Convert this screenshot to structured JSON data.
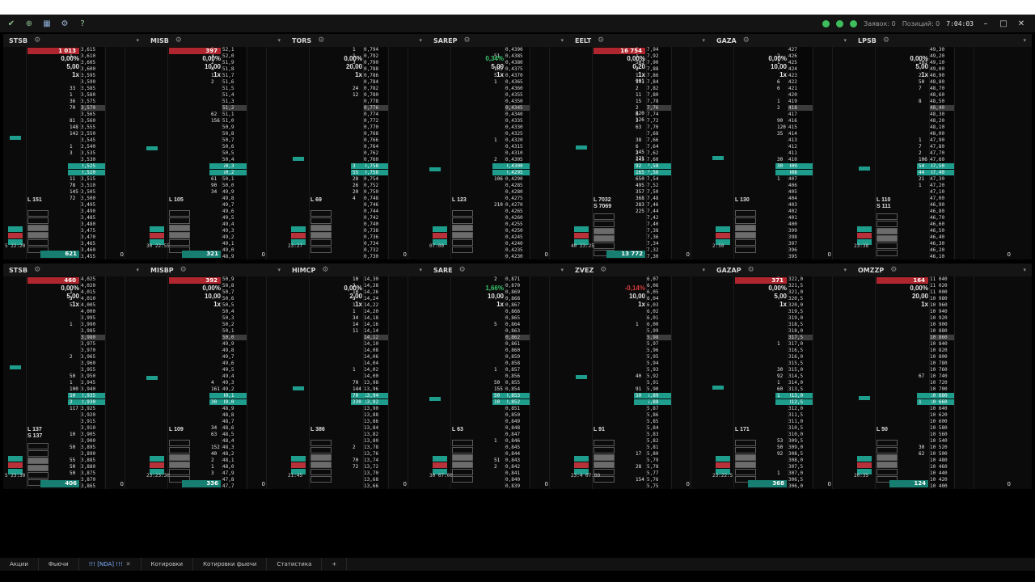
{
  "window": {
    "status_text_1": "Заявок: 0",
    "status_text_2": "Позиций: 0",
    "clock": "7:04:03"
  },
  "panels_top": [
    {
      "ticker": "STSB",
      "redbar": "1 013",
      "pct": "0,00%",
      "lot": "5,00",
      "mult": "1x",
      "ls": [
        "L 151"
      ],
      "bottom": "621",
      "time": "5 22:20",
      "prices": [
        "3,615",
        "3,610",
        "3,605",
        "3,600",
        "3,595",
        "3,590",
        "3,585",
        "3,580",
        "3,575",
        "3,570",
        "3,565",
        "3,560",
        "3,555",
        "3,550",
        "3,545",
        "3,540",
        "3,535",
        "3,530",
        "3,525",
        "3,520",
        "3,515",
        "3,510",
        "3,505",
        "3,500",
        "3,495",
        "3,490",
        "3,485",
        "3,480",
        "3,475",
        "3,470",
        "3,465",
        "3,460",
        "3,455"
      ],
      "vols": [
        "",
        "1",
        "",
        "",
        "",
        "",
        "33",
        "1",
        "36",
        "70",
        "",
        "81",
        "148",
        "142",
        "",
        "1",
        "3",
        "",
        "",
        "",
        "11",
        "78",
        "145",
        "72",
        "",
        "",
        "",
        "",
        "",
        "",
        "",
        "",
        ""
      ]
    },
    {
      "ticker": "MISB",
      "redbar": "397",
      "pct": "0,00%",
      "lot": "10,00",
      "mult": "1x",
      "ls": [
        "L 105"
      ],
      "bottom": "321",
      "time": "30 22:55",
      "prices": [
        "52,1",
        "52,0",
        "51,9",
        "51,8",
        "51,7",
        "51,6",
        "51,5",
        "51,4",
        "51,3",
        "51,2",
        "51,1",
        "51,0",
        "50,9",
        "50,8",
        "50,7",
        "50,6",
        "50,5",
        "50,4",
        "50,3",
        "50,2",
        "50,1",
        "50,0",
        "49,9",
        "49,8",
        "49,7",
        "49,6",
        "49,5",
        "49,4",
        "49,3",
        "49,2",
        "49,1",
        "49,0",
        "48,9"
      ],
      "vols": [
        "1",
        "3",
        "2",
        "4",
        "1",
        "2",
        "",
        "",
        "",
        "",
        "62",
        "156",
        "",
        "",
        "",
        "",
        "",
        "",
        "",
        "",
        "61",
        "90",
        "34",
        "",
        "",
        "",
        "",
        "",
        "",
        "",
        "",
        "",
        ""
      ]
    },
    {
      "ticker": "TORS",
      "redbar": "",
      "pct": "0,00%",
      "lot": "20,00",
      "mult": "1x",
      "ls": [
        "L 69"
      ],
      "bottom": "",
      "time": "23:27",
      "prices": [
        "0,794",
        "0,792",
        "0,790",
        "0,788",
        "0,786",
        "0,784",
        "0,782",
        "0,780",
        "0,778",
        "0,776",
        "0,774",
        "0,772",
        "0,770",
        "0,768",
        "0,766",
        "0,764",
        "0,762",
        "0,760",
        "0,758",
        "0,756",
        "0,754",
        "0,752",
        "0,750",
        "0,748",
        "0,746",
        "0,744",
        "0,742",
        "0,740",
        "0,738",
        "0,736",
        "0,734",
        "0,732",
        "0,730"
      ],
      "vols": [
        "1",
        "1",
        "3",
        "",
        "",
        "",
        "24",
        "12",
        "",
        "",
        "",
        "",
        "",
        "",
        "",
        "",
        "",
        "",
        "3",
        "55",
        "28",
        "26",
        "20",
        "4",
        "",
        "",
        "",
        "",
        "",
        "",
        "",
        "",
        ""
      ]
    },
    {
      "ticker": "SAREP",
      "redbar": "",
      "pct": "0,34%",
      "lot": "5,00",
      "mult": "1x",
      "ls": [
        "L 123"
      ],
      "bottom": "",
      "time": "07:00",
      "prices": [
        "0,4390",
        "0,4385",
        "0,4380",
        "0,4375",
        "0,4370",
        "0,4365",
        "0,4360",
        "0,4355",
        "0,4350",
        "0,4345",
        "0,4340",
        "0,4335",
        "0,4330",
        "0,4325",
        "0,4320",
        "0,4315",
        "0,4310",
        "0,4305",
        "0,4300",
        "0,4295",
        "0,4290",
        "0,4285",
        "0,4280",
        "0,4275",
        "0,4270",
        "0,4265",
        "0,4260",
        "0,4255",
        "0,4250",
        "0,4245",
        "0,4240",
        "0,4235",
        "0,4230"
      ],
      "vols": [
        "",
        "51",
        "",
        "105",
        "5",
        "1",
        "",
        "",
        "",
        "",
        "",
        "",
        "",
        "",
        "1",
        "",
        "",
        "2",
        "",
        "",
        "106",
        "",
        "",
        "",
        "210",
        "",
        "",
        "",
        "",
        "",
        "",
        "",
        ""
      ]
    },
    {
      "ticker": "EELT",
      "redbar": "16 754",
      "pct": "0,00%",
      "lot": "0,20",
      "mult": "1x",
      "ls": [
        "L 7032",
        "S 7069"
      ],
      "bottom": "13 772",
      "time": "40 23:25",
      "prices": [
        "7,94",
        "7,92",
        "7,90",
        "7,88",
        "7,86",
        "7,84",
        "7,82",
        "7,80",
        "7,78",
        "7,76",
        "7,74",
        "7,72",
        "7,70",
        "7,68",
        "7,66",
        "7,64",
        "7,62",
        "7,60",
        "7,58",
        "7,56",
        "7,54",
        "7,52",
        "7,50",
        "7,48",
        "7,46",
        "7,44",
        "7,42",
        "7,40",
        "7,38",
        "7,36",
        "7,34",
        "7,32",
        "7,30"
      ],
      "vols": [
        "2",
        "1",
        "503",
        "2",
        "1 001",
        "191",
        "2",
        "11",
        "15",
        "2 820",
        "6 126",
        "2",
        "63",
        "",
        "38",
        "6 145",
        "2 271",
        "145",
        "92",
        "165",
        "650",
        "495",
        "357",
        "368",
        "283",
        "225",
        "",
        "",
        "",
        "",
        "",
        "",
        ""
      ]
    },
    {
      "ticker": "GAZA",
      "redbar": "",
      "pct": "0,00%",
      "lot": "10,00",
      "mult": "1x",
      "ls": [
        "L 130"
      ],
      "bottom": "",
      "time": "2:50",
      "prices": [
        "427",
        "426",
        "425",
        "424",
        "423",
        "422",
        "421",
        "420",
        "419",
        "418",
        "417",
        "416",
        "415",
        "414",
        "413",
        "412",
        "411",
        "410",
        "409",
        "408",
        "407",
        "406",
        "405",
        "404",
        "403",
        "402",
        "401",
        "400",
        "399",
        "398",
        "397",
        "396",
        "395"
      ],
      "vols": [
        "",
        "2",
        "1",
        "",
        "",
        "6",
        "6",
        "",
        "1",
        "2",
        "",
        "90",
        "120",
        "35",
        "",
        "",
        "",
        "30",
        "30",
        "",
        "1",
        "",
        "",
        "",
        "",
        "",
        "",
        "",
        "",
        "",
        "",
        "",
        ""
      ]
    },
    {
      "ticker": "LPSB",
      "redbar": "",
      "pct": "0,00%",
      "lot": "5,00",
      "mult": "1x",
      "ls": [
        "L 110",
        "S 111"
      ],
      "bottom": "",
      "time": "23:38",
      "prices": [
        "49,30",
        "49,20",
        "49,10",
        "49,00",
        "48,90",
        "48,80",
        "48,70",
        "48,60",
        "48,50",
        "48,40",
        "48,30",
        "48,20",
        "48,10",
        "48,00",
        "47,90",
        "47,80",
        "47,70",
        "47,60",
        "47,50",
        "47,40",
        "47,30",
        "47,20",
        "47,10",
        "47,00",
        "46,90",
        "46,80",
        "46,70",
        "46,60",
        "46,50",
        "46,40",
        "46,30",
        "46,20",
        "46,10"
      ],
      "vols": [
        "",
        "",
        "103",
        "",
        "2",
        "50",
        "7",
        "",
        "8",
        "",
        "",
        "",
        "",
        "",
        "1",
        "7",
        "2",
        "106",
        "54",
        "44",
        "21",
        "1",
        "",
        "",
        "",
        "",
        "",
        "",
        "",
        "",
        "",
        "",
        ""
      ]
    }
  ],
  "panels_bottom": [
    {
      "ticker": "STSB",
      "redbar": "460",
      "pct": "0,00%",
      "lot": "5,00",
      "mult": "1x",
      "ls": [
        "L 137",
        "S 137"
      ],
      "bottom": "406",
      "time": "5 23:30",
      "prices": [
        "4,025",
        "4,020",
        "4,015",
        "4,010",
        "4,005",
        "4,000",
        "3,995",
        "3,990",
        "3,985",
        "3,980",
        "3,975",
        "3,970",
        "3,965",
        "3,960",
        "3,955",
        "3,950",
        "3,945",
        "3,940",
        "3,935",
        "3,930",
        "3,925",
        "3,920",
        "3,915",
        "3,910",
        "3,905",
        "3,900",
        "3,895",
        "3,890",
        "3,885",
        "3,880",
        "3,875",
        "3,870",
        "3,865"
      ],
      "vols": [
        "",
        "",
        "1",
        "3",
        "5",
        "",
        "",
        "1",
        "",
        "",
        "",
        "",
        "2",
        "",
        "",
        "50",
        "1",
        "100",
        "50",
        "2",
        "117",
        "",
        "",
        "",
        "10",
        "",
        "50",
        "",
        "55",
        "50",
        "50",
        "",
        ""
      ]
    },
    {
      "ticker": "MISBP",
      "redbar": "392",
      "pct": "0,00%",
      "lot": "10,00",
      "mult": "1x",
      "ls": [
        "L 109"
      ],
      "bottom": "336",
      "time": "23:23:30",
      "prices": [
        "50,9",
        "50,8",
        "50,7",
        "50,6",
        "50,5",
        "50,4",
        "50,3",
        "50,2",
        "50,1",
        "50,0",
        "49,9",
        "49,8",
        "49,7",
        "49,6",
        "49,5",
        "49,4",
        "49,3",
        "49,2",
        "49,1",
        "49,0",
        "48,9",
        "48,8",
        "48,7",
        "48,6",
        "48,5",
        "48,4",
        "48,3",
        "48,2",
        "48,1",
        "48,0",
        "47,9",
        "47,8",
        "47,7"
      ],
      "vols": [
        "",
        "",
        "",
        "",
        "",
        "",
        "",
        "",
        "",
        "",
        "",
        "",
        "",
        "",
        "",
        "",
        "4",
        "161",
        "",
        "30",
        "",
        "",
        "",
        "34",
        "63",
        "",
        "152",
        "40",
        "2",
        "1",
        "3",
        "",
        ""
      ]
    },
    {
      "ticker": "HIMCP",
      "redbar": "",
      "pct": "0,00%",
      "lot": "2,00",
      "mult": "1x",
      "ls": [
        "L 386"
      ],
      "bottom": "",
      "time": "21:45",
      "prices": [
        "14,30",
        "14,28",
        "14,26",
        "14,24",
        "14,22",
        "14,20",
        "14,18",
        "14,16",
        "14,14",
        "14,12",
        "14,10",
        "14,08",
        "14,06",
        "14,04",
        "14,02",
        "14,00",
        "13,98",
        "13,96",
        "13,94",
        "13,92",
        "13,90",
        "13,88",
        "13,86",
        "13,84",
        "13,82",
        "13,80",
        "13,78",
        "13,76",
        "13,74",
        "13,72",
        "13,70",
        "13,68",
        "13,66"
      ],
      "vols": [
        "10",
        "3",
        "10",
        "3",
        "1",
        "1",
        "34",
        "14",
        "11",
        "",
        "",
        "",
        "",
        "",
        "1",
        "",
        "70",
        "144",
        "70",
        "230",
        "",
        "",
        "",
        "",
        "",
        "",
        "2",
        "",
        "70",
        "72",
        "",
        "",
        ""
      ]
    },
    {
      "ticker": "SARE",
      "redbar": "",
      "pct": "1,66%",
      "lot": "10,00",
      "mult": "1x",
      "ls": [
        "L 63"
      ],
      "bottom": "",
      "time": "30 07:00",
      "prices": [
        "0,871",
        "0,870",
        "0,869",
        "0,868",
        "0,867",
        "0,866",
        "0,865",
        "0,864",
        "0,863",
        "0,862",
        "0,861",
        "0,860",
        "0,859",
        "0,858",
        "0,857",
        "0,856",
        "0,855",
        "0,854",
        "0,853",
        "0,852",
        "0,851",
        "0,850",
        "0,849",
        "0,848",
        "0,847",
        "0,846",
        "0,845",
        "0,844",
        "0,843",
        "0,842",
        "0,841",
        "0,840",
        "0,839"
      ],
      "vols": [
        "2",
        "",
        "",
        "",
        "",
        "",
        "",
        "5",
        "",
        "",
        "",
        "",
        "",
        "",
        "1",
        "",
        "50",
        "155",
        "50",
        "10",
        "",
        "",
        "",
        "",
        "",
        "1",
        "",
        "",
        "51",
        "2",
        "",
        "",
        ""
      ]
    },
    {
      "ticker": "ZVEZ",
      "redbar": "",
      "pct": "-0,14%",
      "lot": "10,00",
      "mult": "1x",
      "ls": [
        "L 91"
      ],
      "bottom": "",
      "time": "23:4 07:00",
      "prices": [
        "6,07",
        "6,06",
        "6,05",
        "6,04",
        "6,03",
        "6,02",
        "6,01",
        "6,00",
        "5,99",
        "5,98",
        "5,97",
        "5,96",
        "5,95",
        "5,94",
        "5,93",
        "5,92",
        "5,91",
        "5,90",
        "5,89",
        "5,88",
        "5,87",
        "5,86",
        "5,85",
        "5,84",
        "5,83",
        "5,82",
        "5,81",
        "5,80",
        "5,79",
        "5,78",
        "5,77",
        "5,76",
        "5,75"
      ],
      "vols": [
        "",
        "",
        "",
        "",
        "",
        "",
        "",
        "1",
        "",
        "",
        "",
        "",
        "",
        "",
        "",
        "40",
        "",
        "91",
        "50",
        "",
        "",
        "",
        "",
        "",
        "",
        "",
        "",
        "17",
        "",
        "28",
        "",
        "154",
        ""
      ]
    },
    {
      "ticker": "GAZAP",
      "redbar": "371",
      "pct": "0,00%",
      "lot": "5,00",
      "mult": "1x",
      "ls": [
        "L 171"
      ],
      "bottom": "368",
      "time": "23:22:5",
      "prices": [
        "322,0",
        "321,5",
        "321,0",
        "320,5",
        "320,0",
        "319,5",
        "319,0",
        "318,5",
        "318,0",
        "317,5",
        "317,0",
        "316,5",
        "316,0",
        "315,5",
        "315,0",
        "314,5",
        "314,0",
        "313,5",
        "313,0",
        "312,5",
        "312,0",
        "311,5",
        "311,0",
        "310,5",
        "310,0",
        "309,5",
        "309,0",
        "308,5",
        "308,0",
        "307,5",
        "307,0",
        "306,5",
        "306,0"
      ],
      "vols": [
        "2",
        "",
        "",
        "",
        "",
        "",
        "",
        "",
        "",
        "",
        "1",
        "",
        "",
        "",
        "30",
        "92",
        "1",
        "60",
        "1",
        "",
        "",
        "",
        "",
        "",
        "",
        "53",
        "50",
        "92",
        "",
        "",
        "1",
        "",
        ""
      ]
    },
    {
      "ticker": "OMZZP",
      "redbar": "164",
      "pct": "0,00%",
      "lot": "20,00",
      "mult": "1x",
      "ls": [
        "L 50"
      ],
      "bottom": "124",
      "time": "20:35",
      "prices": [
        "11 040",
        "11 020",
        "11 000",
        "10 980",
        "10 960",
        "10 940",
        "10 920",
        "10 900",
        "10 880",
        "10 860",
        "10 840",
        "10 820",
        "10 800",
        "10 780",
        "10 760",
        "10 740",
        "10 720",
        "10 700",
        "10 680",
        "10 660",
        "10 640",
        "10 620",
        "10 600",
        "10 580",
        "10 560",
        "10 540",
        "10 520",
        "10 500",
        "10 480",
        "10 460",
        "10 440",
        "10 420",
        "10 400"
      ],
      "vols": [
        "",
        "",
        "",
        "",
        "",
        "",
        "",
        "",
        "",
        "",
        "",
        "",
        "",
        "",
        "",
        "67",
        "",
        "",
        "",
        "1",
        "",
        "",
        "",
        "",
        "",
        "",
        "30",
        "62",
        "",
        "",
        "",
        "",
        ""
      ]
    }
  ],
  "tabs": [
    "Акции",
    "Фьючи",
    "!!! [NDA] !!!",
    "Котировки",
    "Котировки фьючи",
    "Статистика",
    "+"
  ],
  "colors": {
    "accent": "#1e9c8c",
    "sell": "#b0262e",
    "green": "#39c46b",
    "red": "#d63b3b",
    "bg": "#0b0b0b"
  }
}
